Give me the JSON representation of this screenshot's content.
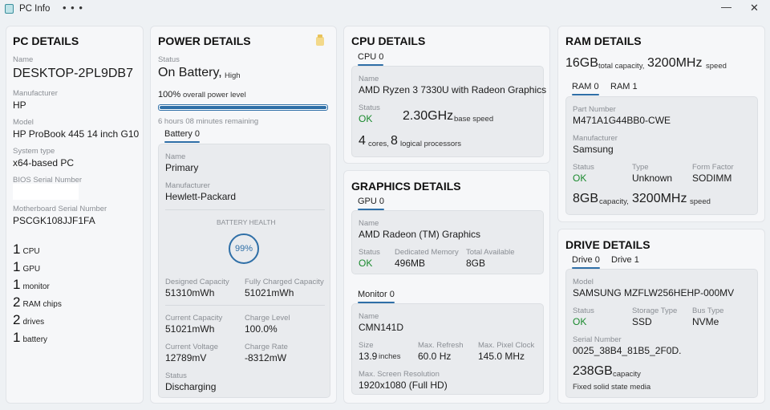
{
  "window": {
    "title": "PC Info",
    "more": "• • •",
    "minimize": "—",
    "close": "✕"
  },
  "pc": {
    "heading": "PC DETAILS",
    "name_label": "Name",
    "name": "DESKTOP-2PL9DB7",
    "manufacturer_label": "Manufacturer",
    "manufacturer": "HP",
    "model_label": "Model",
    "model": "HP ProBook 445 14 inch G10...",
    "system_type_label": "System type",
    "system_type": "x64-based PC",
    "bios_label": "BIOS Serial Number",
    "mb_label": "Motherboard Serial Number",
    "mb_serial": "PSCGK108JJF1FA",
    "counts": [
      {
        "n": "1",
        "t": "CPU"
      },
      {
        "n": "1",
        "t": "GPU"
      },
      {
        "n": "1",
        "t": "monitor"
      },
      {
        "n": "2",
        "t": "RAM chips"
      },
      {
        "n": "2",
        "t": "drives"
      },
      {
        "n": "1",
        "t": "battery"
      }
    ]
  },
  "power": {
    "heading": "POWER DETAILS",
    "status_label": "Status",
    "status": "On Battery,",
    "status_sub": "High",
    "level_pct": "100%",
    "level_text": "overall power level",
    "level_fraction": 1.0,
    "remaining": "6 hours 08 minutes remaining",
    "tab": "Battery 0",
    "name_label": "Name",
    "name": "Primary",
    "manufacturer_label": "Manufacturer",
    "manufacturer": "Hewlett-Packard",
    "health_label": "BATTERY HEALTH",
    "health": "99%",
    "designed_label": "Designed Capacity",
    "designed": "51310mWh",
    "full_label": "Fully Charged Capacity",
    "full": "51021mWh",
    "current_label": "Current Capacity",
    "current": "51021mWh",
    "charge_level_label": "Charge Level",
    "charge_level": "100.0%",
    "voltage_label": "Current Voltage",
    "voltage": "12789mV",
    "rate_label": "Charge Rate",
    "rate": "-8312mW",
    "bstatus_label": "Status",
    "bstatus": "Discharging"
  },
  "cpu": {
    "heading": "CPU DETAILS",
    "tab": "CPU 0",
    "name_label": "Name",
    "name": "AMD Ryzen 3 7330U with Radeon Graphics",
    "status_label": "Status",
    "status": "OK",
    "speed": "2.30GHz",
    "speed_text": "base speed",
    "cores": "4",
    "cores_text": "cores,",
    "threads": "8",
    "threads_text": "logical processors"
  },
  "gpu": {
    "heading": "GRAPHICS DETAILS",
    "tab": "GPU 0",
    "name_label": "Name",
    "name": "AMD Radeon (TM) Graphics",
    "status_label": "Status",
    "status": "OK",
    "dedicated_label": "Dedicated Memory",
    "dedicated": "496MB",
    "total_label": "Total Available",
    "total": "8GB",
    "monitor_tab": "Monitor 0",
    "mname_label": "Name",
    "mname": "CMN141D",
    "size_label": "Size",
    "size": "13.9",
    "size_unit": "inches",
    "refresh_label": "Max. Refresh",
    "refresh": "60.0 Hz",
    "clock_label": "Max. Pixel Clock",
    "clock": "145.0 MHz",
    "res_label": "Max. Screen Resolution",
    "res": "1920x1080 (Full HD)"
  },
  "ram": {
    "heading": "RAM DETAILS",
    "total": "16GB",
    "total_text": "total capacity,",
    "speed": "3200MHz",
    "speed_text": "speed",
    "tabs": [
      "RAM 0",
      "RAM 1"
    ],
    "part_label": "Part Number",
    "part": "M471A1G44BB0-CWE",
    "manufacturer_label": "Manufacturer",
    "manufacturer": "Samsung",
    "status_label": "Status",
    "status": "OK",
    "type_label": "Type",
    "type": "Unknown",
    "ff_label": "Form Factor",
    "ff": "SODIMM",
    "cap": "8GB",
    "cap_text": "capacity,",
    "cap_speed": "3200MHz",
    "cap_speed_text": "speed"
  },
  "drive": {
    "heading": "DRIVE DETAILS",
    "tabs": [
      "Drive 0",
      "Drive 1"
    ],
    "model_label": "Model",
    "model": "SAMSUNG MZFLW256HEHP-000MV",
    "status_label": "Status",
    "status": "OK",
    "storage_label": "Storage Type",
    "storage": "SSD",
    "bus_label": "Bus Type",
    "bus": "NVMe",
    "serial_label": "Serial Number",
    "serial": "0025_38B4_81B5_2F0D.",
    "cap": "238GB",
    "cap_text": "capacity",
    "media": "Fixed solid state media"
  },
  "colors": {
    "accent": "#2f6fa7",
    "ok": "#1a8a2e",
    "bg": "#eef1f4",
    "card": "#f6f7f9"
  }
}
